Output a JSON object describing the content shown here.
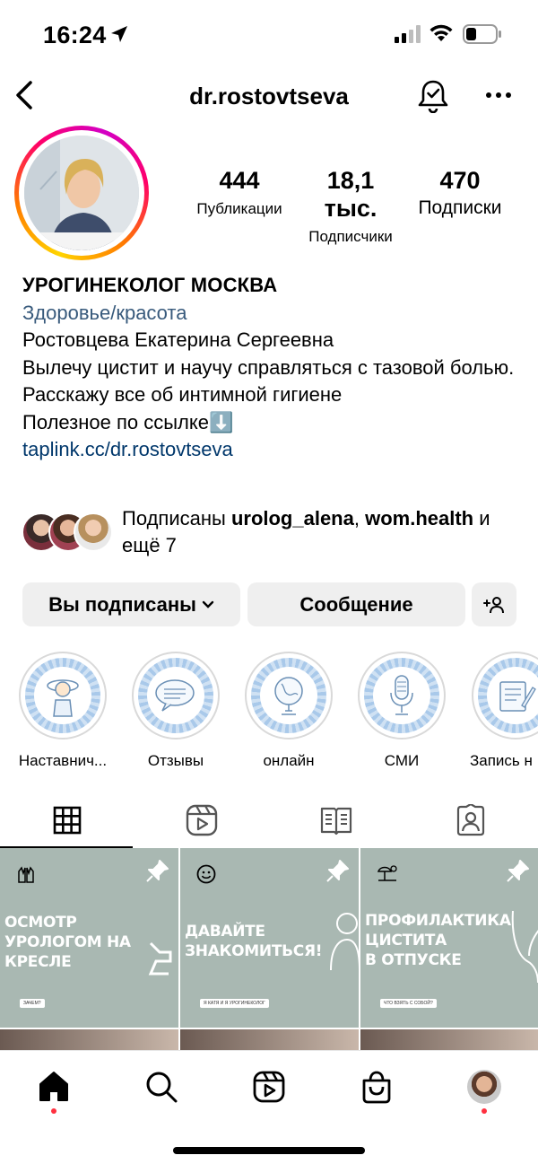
{
  "status_bar": {
    "time": "16:24"
  },
  "header": {
    "username": "dr.rostovtseva"
  },
  "stats": [
    {
      "value": "444",
      "label": "Публикации"
    },
    {
      "value": "18,1 тыс.",
      "label": "Подписчики"
    },
    {
      "value": "470",
      "label": "Подписки"
    }
  ],
  "bio": {
    "name": "УРОГИНЕКОЛОГ МОСКВА",
    "category": "Здоровье/красота",
    "lines": [
      "Ростовцева Екатерина Сергеевна",
      "Вылечу цистит и научу справляться с тазовой болью.",
      "Расскажу все об интимной гигиене",
      "Полезное по ссылке⬇️"
    ],
    "link": "taplink.cc/dr.rostovtseva"
  },
  "followed_by": {
    "prefix": "Подписаны",
    "user1": "urolog_alena",
    "user2": "wom.health",
    "suffix": "и ещё 7"
  },
  "buttons": {
    "following": "Вы подписаны",
    "message": "Сообщение"
  },
  "highlights": [
    {
      "label": "Наставнич...",
      "icon": "girl-icon"
    },
    {
      "label": "Отзывы",
      "icon": "chat-bubbles-icon"
    },
    {
      "label": "онлайн",
      "icon": "globe-icon"
    },
    {
      "label": "СМИ",
      "icon": "microphone-icon"
    },
    {
      "label": "Запись н",
      "icon": "notepad-icon"
    }
  ],
  "posts": [
    {
      "title": "ОСМОТР\nУРОЛОГОМ НА\nКРЕСЛЕ",
      "tag": "ЗАЧЕМ?"
    },
    {
      "title": "ДАВАЙТЕ\nЗНАКОМИТЬСЯ!",
      "tag": "Я КАТЯ И Я УРОГИНЕКОЛОГ"
    },
    {
      "title": "ПРОФИЛАКТИКА\nЦИСТИТА\nВ ОТПУСКЕ",
      "tag": "ЧТО ВЗЯТЬ С СОБОЙ?"
    }
  ],
  "colors": {
    "link": "#00376b",
    "category": "#385a7c",
    "post_bg": "#a9b8b2",
    "notification_dot": "#ff3040"
  }
}
